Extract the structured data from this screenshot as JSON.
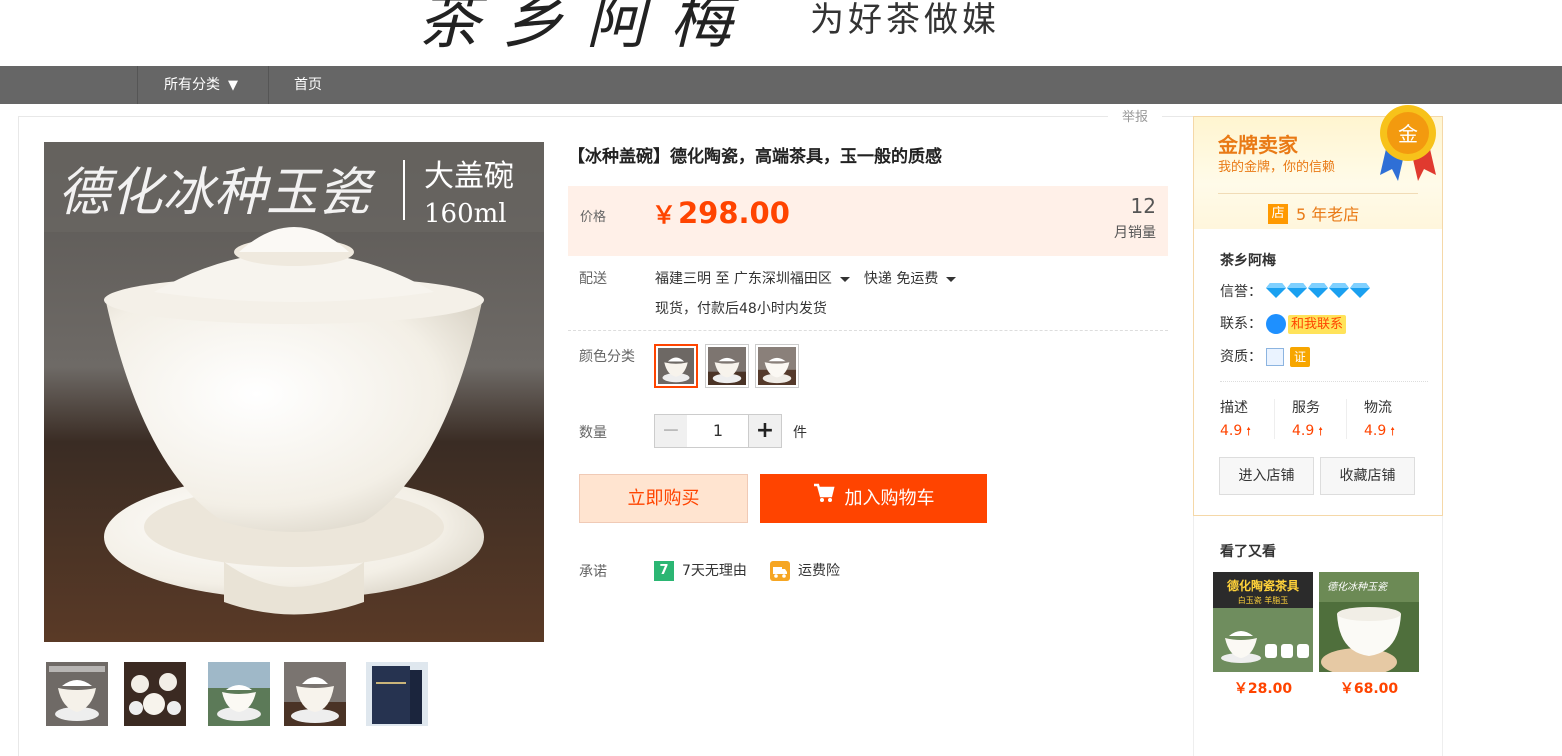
{
  "banner": {
    "shop_name": "茶乡阿梅",
    "slogan": "为好茶做媒"
  },
  "nav": {
    "all_categories": "所有分类",
    "caret": "▼",
    "home": "首页"
  },
  "report_label": "举报",
  "gallery": {
    "main_image_text": "德化冰种玉瓷",
    "main_image_tag": "大盖碗",
    "main_image_volume": "160ml",
    "thumbnail_count": 5
  },
  "product": {
    "title": "【冰种盖碗】德化陶瓷，高端茶具，玉一般的质感",
    "price_label": "价格",
    "currency": "￥",
    "price": "298.00",
    "monthly_sales": "12",
    "monthly_sales_label": "月销量",
    "shipping_label": "配送",
    "ship_from": "福建三明 至",
    "ship_to": "广东深圳福田区",
    "ship_method": "快递 免运费",
    "ship_note": "现货，付款后48小时内发货",
    "color_label": "颜色分类",
    "color_option_count": 3,
    "selected_color_index": 0,
    "qty_label": "数量",
    "qty_value": "1",
    "qty_minus": "−",
    "qty_plus": "+",
    "qty_unit": "件",
    "buy_now": "立即购买",
    "add_to_cart": "加入购物车",
    "promise_label": "承诺",
    "promise_return": "7天无理由",
    "promise_return_icon": "7",
    "promise_freight": "运费险"
  },
  "seller": {
    "gold_title": "金牌卖家",
    "gold_sub": "我的金牌，你的信赖",
    "medal_text": "金",
    "shop_tag": "店",
    "shop_age": "5 年老店",
    "shop_name": "茶乡阿梅",
    "credit_label": "信誉：",
    "credit_diamonds": 5,
    "contact_label": "联系：",
    "contact_text": "和我联系",
    "cert_label": "资质：",
    "cert_text": "证",
    "scores": [
      {
        "label": "描述",
        "value": "4.9",
        "arrow": "🠕"
      },
      {
        "label": "服务",
        "value": "4.9",
        "arrow": "🠕"
      },
      {
        "label": "物流",
        "value": "4.9",
        "arrow": "🠕"
      }
    ],
    "enter_shop": "进入店铺",
    "fav_shop": "收藏店铺"
  },
  "also_viewed": {
    "title": "看了又看",
    "items": [
      {
        "price": "￥28.00",
        "banner": "德化陶瓷茶具",
        "sub": "白玉瓷 羊脂玉"
      },
      {
        "price": "￥68.00",
        "banner": "德化冰种玉瓷"
      }
    ]
  },
  "colors": {
    "accent": "#ff4400",
    "nav_bg": "#666666",
    "gold": "#e97a16",
    "price_bg": "#fff0e8"
  }
}
